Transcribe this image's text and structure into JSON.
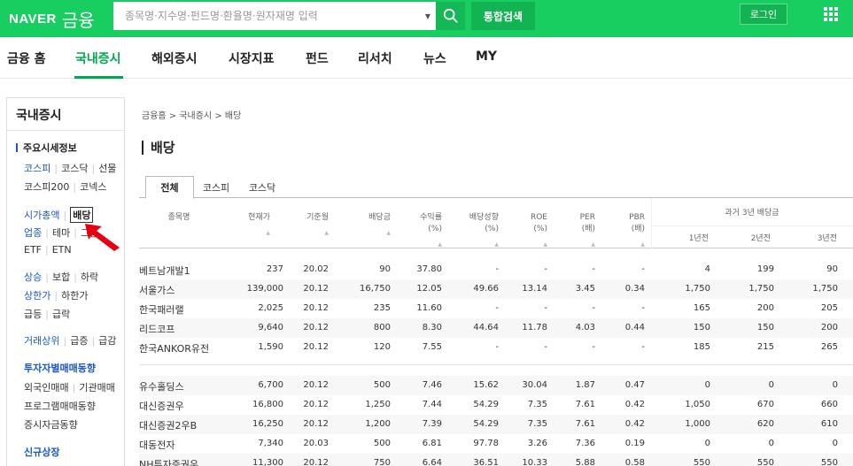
{
  "header": {
    "logo_naver": "NAVER",
    "logo_finance": "금융",
    "search_placeholder": "종목명·지수명·펀드명·환율명·원자재명 입력",
    "integrated_search": "통합검색",
    "login": "로그인",
    "brand_color": "#19ce60"
  },
  "nav": {
    "items": [
      "금융 홈",
      "국내증시",
      "해외증시",
      "시장지표",
      "펀드",
      "리서치",
      "뉴스",
      "MY"
    ],
    "active": "국내증시"
  },
  "sidebar": {
    "title": "국내증시",
    "section_main": "주요시세정보",
    "row1": [
      "코스피",
      "코스닥",
      "선물"
    ],
    "row2": [
      "코스피200",
      "코넥스"
    ],
    "row3": [
      "시가총액",
      "배당"
    ],
    "row4": [
      "업종",
      "테마",
      "그룹"
    ],
    "row5": [
      "ETF",
      "ETN"
    ],
    "row6": [
      "상승",
      "보합",
      "하락"
    ],
    "row7": [
      "상한가",
      "하한가"
    ],
    "row8": [
      "급등",
      "급락"
    ],
    "row9": [
      "거래상위",
      "급증",
      "급감"
    ],
    "section_investor": "투자자별매매동향",
    "row10": [
      "외국인매매",
      "기관매매"
    ],
    "row11": "프로그램매매동향",
    "row12": "증시자금동향",
    "section_new": "신규상장"
  },
  "breadcrumb": "금융홈 > 국내증시 > 배당",
  "page_title": "배당",
  "tabs": [
    "전체",
    "코스피",
    "코스닥"
  ],
  "table": {
    "headers": {
      "name": "종목명",
      "price": "현재가",
      "base_month": "기준월",
      "dividend": "배당금",
      "yield": [
        "수익률",
        "(%)"
      ],
      "payout": [
        "배당성향",
        "(%)"
      ],
      "roe": [
        "ROE",
        "(%)"
      ],
      "per": [
        "PER",
        "(배)"
      ],
      "pbr": [
        "PBR",
        "(배)"
      ],
      "past3": "과거 3년 배당금",
      "y1": "1년전",
      "y2": "2년전",
      "y3": "3년전"
    },
    "rows": [
      [
        "베트남개발1",
        "237",
        "20.02",
        "90",
        "37.80",
        "-",
        "-",
        "-",
        "-",
        "4",
        "199",
        "90"
      ],
      [
        "서울가스",
        "139,000",
        "20.12",
        "16,750",
        "12.05",
        "49.66",
        "13.14",
        "3.45",
        "0.34",
        "1,750",
        "1,750",
        "1,750"
      ],
      [
        "한국패러랠",
        "2,025",
        "20.12",
        "235",
        "11.60",
        "-",
        "-",
        "-",
        "-",
        "165",
        "200",
        "205"
      ],
      [
        "리드코프",
        "9,640",
        "20.12",
        "800",
        "8.30",
        "44.64",
        "11.78",
        "4.03",
        "0.44",
        "150",
        "150",
        "200"
      ],
      [
        "한국ANKOR유전",
        "1,590",
        "20.12",
        "120",
        "7.55",
        "-",
        "-",
        "-",
        "-",
        "185",
        "215",
        "265"
      ],
      [
        "유수홀딩스",
        "6,700",
        "20.12",
        "500",
        "7.46",
        "15.62",
        "30.04",
        "1.87",
        "0.47",
        "0",
        "0",
        "0"
      ],
      [
        "대신증권우",
        "16,800",
        "20.12",
        "1,250",
        "7.44",
        "54.29",
        "7.35",
        "7.61",
        "0.42",
        "1,050",
        "670",
        "660"
      ],
      [
        "대신증권2우B",
        "16,250",
        "20.12",
        "1,200",
        "7.39",
        "54.29",
        "7.35",
        "7.61",
        "0.42",
        "1,000",
        "620",
        "610"
      ],
      [
        "대동전자",
        "7,340",
        "20.03",
        "500",
        "6.81",
        "97.78",
        "3.26",
        "7.36",
        "0.19",
        "0",
        "0",
        "0"
      ],
      [
        "NH투자증권우",
        "11,300",
        "20.12",
        "750",
        "6.64",
        "36.51",
        "10.33",
        "5.88",
        "0.58",
        "550",
        "550",
        "550"
      ]
    ]
  }
}
